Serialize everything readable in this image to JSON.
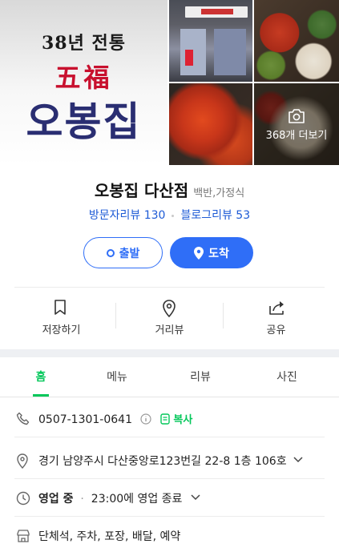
{
  "logo": {
    "line1": "38년 전통",
    "line2": "五福",
    "line3": "오봉집"
  },
  "photos": {
    "more_label": "368개 더보기"
  },
  "place": {
    "name": "오봉집 다산점",
    "category": "백반,가정식",
    "visitor_reviews": "방문자리뷰 130",
    "blog_reviews": "블로그리뷰 53"
  },
  "nav_buttons": {
    "departure": "출발",
    "arrival": "도착"
  },
  "actions": {
    "save": "저장하기",
    "street_view": "거리뷰",
    "share": "공유"
  },
  "tabs": [
    "홈",
    "메뉴",
    "리뷰",
    "사진"
  ],
  "info": {
    "phone": "0507-1301-0641",
    "copy_label": "복사",
    "address": "경기 남양주시 다산중앙로123번길 22-8 1층 106호",
    "status": "영업 중",
    "hours": "23:00에 영업 종료",
    "facilities": "단체석, 주차, 포장, 배달, 예약"
  },
  "colors": {
    "accent_blue": "#2f6ef7",
    "link_blue": "#1e5bd6",
    "naver_green": "#03c75a"
  }
}
